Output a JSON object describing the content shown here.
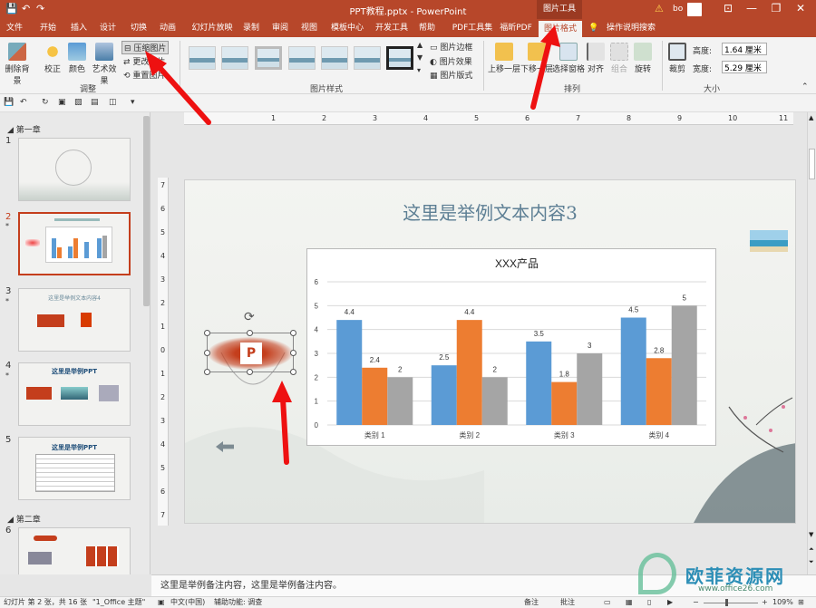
{
  "titlebar": {
    "title": "PPT教程.pptx - PowerPoint",
    "context_tab": "图片工具",
    "user": "bo",
    "minimize": "—",
    "restore": "❐",
    "close": "✕"
  },
  "tabs": [
    {
      "label": "文件"
    },
    {
      "label": "开始"
    },
    {
      "label": "插入"
    },
    {
      "label": "设计"
    },
    {
      "label": "切换"
    },
    {
      "label": "动画"
    },
    {
      "label": "幻灯片放映"
    },
    {
      "label": "录制"
    },
    {
      "label": "审阅"
    },
    {
      "label": "视图"
    },
    {
      "label": "模板中心"
    },
    {
      "label": "开发工具"
    },
    {
      "label": "帮助"
    },
    {
      "label": "PDF工具集"
    },
    {
      "label": "福昕PDF"
    },
    {
      "label": "图片格式"
    },
    {
      "label": "操作说明搜索"
    }
  ],
  "ribbon": {
    "remove_bg": "删除背景",
    "correct": "校正",
    "color": "颜色",
    "artistic": "艺术效果",
    "compress": "压缩图片",
    "change": "更改图片",
    "reset": "重置图片",
    "adjust_group": "调整",
    "styles_group": "图片样式",
    "border": "图片边框",
    "effects": "图片效果",
    "layout": "图片版式",
    "bring_forward": "上移一层",
    "send_backward": "下移一层",
    "selection_pane": "选择窗格",
    "align": "对齐",
    "group": "组合",
    "rotate": "旋转",
    "arrange_group": "排列",
    "crop": "裁剪",
    "height_label": "高度:",
    "height_value": "1.64 厘米",
    "width_label": "宽度:",
    "width_value": "5.29 厘米",
    "size_group": "大小"
  },
  "slides_panel": {
    "section1": "第一章",
    "section2": "第二章",
    "slides": [
      {
        "num": "1"
      },
      {
        "num": "2",
        "star": "*"
      },
      {
        "num": "3",
        "star": "*"
      },
      {
        "num": "4",
        "star": "*"
      },
      {
        "num": "5"
      },
      {
        "num": "6"
      }
    ],
    "thumb3_title": "这里是举例文本内容4",
    "thumb4_title": "这里是举例PPT",
    "thumb5_title": "这里是举例PPT"
  },
  "ruler": {
    "h": [
      "1",
      "2",
      "3",
      "4",
      "5",
      "6",
      "7",
      "8",
      "9",
      "10",
      "11",
      "12"
    ],
    "v": [
      "7",
      "6",
      "5",
      "4",
      "3",
      "2",
      "1",
      "0",
      "1",
      "2",
      "3",
      "4",
      "5",
      "6",
      "7"
    ]
  },
  "slide": {
    "title": "这里是举例文本内容3",
    "ppt_letter": "P"
  },
  "chart_data": {
    "type": "bar",
    "title": "XXX产品",
    "categories": [
      "类别 1",
      "类别 2",
      "类别 3",
      "类别 4"
    ],
    "series": [
      {
        "values": [
          4.4,
          2.5,
          3.5,
          4.5
        ],
        "color": "#5b9bd5"
      },
      {
        "values": [
          2.4,
          4.4,
          1.8,
          2.8
        ],
        "color": "#ed7d31"
      },
      {
        "values": [
          2,
          2,
          3,
          5
        ],
        "color": "#a5a5a5"
      }
    ],
    "ylim": [
      0,
      6
    ],
    "yticks": [
      "0",
      "1",
      "2",
      "3",
      "4",
      "5",
      "6"
    ],
    "data_labels": true,
    "grid": true
  },
  "notes": "这里是举例备注内容，这里是举例备注内容。",
  "status": {
    "slide_info": "幻灯片 第 2 张，共 16 张",
    "theme": "\"1_Office 主题\"",
    "lang": "中文(中国)",
    "accessibility": "辅助功能: 调查",
    "notes_btn": "备注",
    "comments_btn": "批注",
    "zoom": "109%"
  },
  "watermark": {
    "text": "欧菲资源网",
    "url": "www.office26.com"
  }
}
